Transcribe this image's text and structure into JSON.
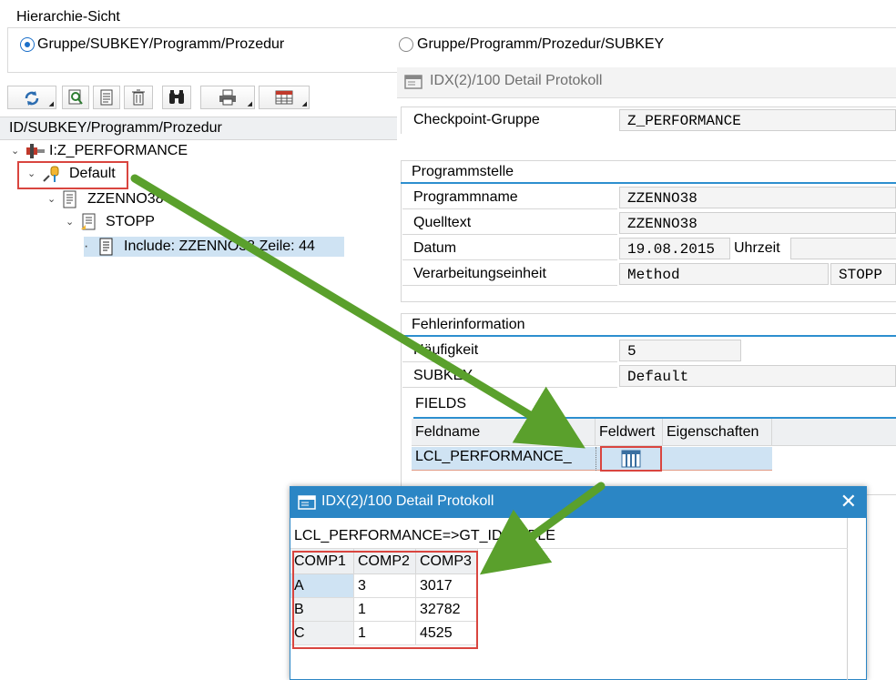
{
  "hierarchy": {
    "title": "Hierarchie-Sicht",
    "option1": "Gruppe/SUBKEY/Programm/Prozedur",
    "option2": "Gruppe/Programm/Prozedur/SUBKEY",
    "selected": "option1"
  },
  "toolbar": {
    "icons": [
      "refresh-icon",
      "search-icon",
      "detail-icon",
      "delete-icon",
      "find-icon",
      "print-icon",
      "layout-icon"
    ]
  },
  "tree": {
    "header": "ID/SUBKEY/Programm/Prozedur",
    "nodes": {
      "root": "I:Z_PERFORMANCE",
      "default": "Default",
      "program": "ZZENNO38",
      "procedure": "STOPP",
      "include": "Include: ZZENNO38  Zeile: 44"
    }
  },
  "detail": {
    "title": "IDX(2)/100 Detail Protokoll",
    "checkpoint_label": "Checkpoint-Gruppe",
    "checkpoint_value": "Z_PERFORMANCE",
    "programmstelle": {
      "title": "Programmstelle",
      "programmname_label": "Programmname",
      "programmname_value": "ZZENNO38",
      "quelltext_label": "Quelltext",
      "quelltext_value": "ZZENNO38",
      "datum_label": "Datum",
      "datum_value": "19.08.2015",
      "uhrzeit_label": "Uhrzeit",
      "verarbeitung_label": "Verarbeitungseinheit",
      "verarbeitung_type": "Method",
      "verarbeitung_name": "STOPP"
    },
    "fehlerinfo": {
      "title": "Fehlerinformation",
      "haeufigkeit_label": "Häufigkeit",
      "haeufigkeit_value": "5",
      "subkey_label": "SUBKEY",
      "subkey_value": "Default",
      "fields_title": "FIELDS",
      "columns": [
        "Feldname",
        "Feldwert",
        "Eigenschaften"
      ],
      "row_feldname": "LCL_PERFORMANCE_"
    }
  },
  "popup": {
    "title": "IDX(2)/100 Detail Protokoll",
    "object_path": "LCL_PERFORMANCE=>GT_ID_TABLE",
    "columns": [
      "COMP1",
      "COMP2",
      "COMP3"
    ],
    "rows": [
      [
        "A",
        "3",
        "3017"
      ],
      [
        "B",
        "1",
        "32782"
      ],
      [
        "C",
        "1",
        "4525"
      ]
    ]
  },
  "colors": {
    "accent": "#2b86c5",
    "highlight_box": "#d9453f",
    "arrow": "#5aa02c",
    "selection": "#cfe3f3"
  }
}
